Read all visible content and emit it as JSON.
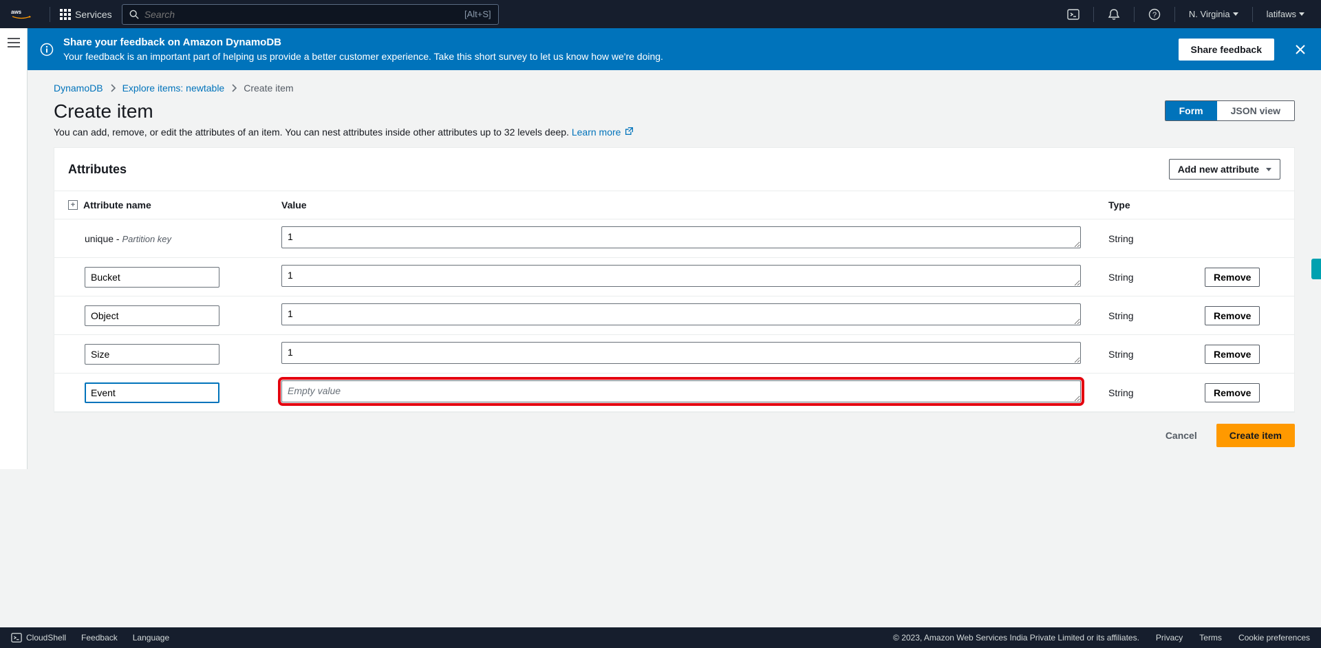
{
  "topnav": {
    "services_label": "Services",
    "search_placeholder": "Search",
    "search_shortcut": "[Alt+S]",
    "region": "N. Virginia",
    "user": "latifaws"
  },
  "banner": {
    "title": "Share your feedback on Amazon DynamoDB",
    "desc": "Your feedback is an important part of helping us provide a better customer experience. Take this short survey to let us know how we're doing.",
    "button": "Share feedback"
  },
  "breadcrumbs": {
    "root": "DynamoDB",
    "explore": "Explore items: newtable",
    "current": "Create item"
  },
  "page": {
    "title": "Create item",
    "desc_prefix": "You can add, remove, or edit the attributes of an item. You can nest attributes inside other attributes up to 32 levels deep. ",
    "learn_more": "Learn more"
  },
  "toggle": {
    "form": "Form",
    "json": "JSON view"
  },
  "panel": {
    "title": "Attributes",
    "add_button": "Add new attribute",
    "cols": {
      "name": "Attribute name",
      "value": "Value",
      "type": "Type"
    },
    "remove": "Remove",
    "empty_placeholder": "Empty value"
  },
  "attributes": {
    "pk": {
      "name": "unique",
      "label": "Partition key",
      "value": "1",
      "type": "String"
    },
    "rows": [
      {
        "name": "Bucket",
        "value": "1",
        "type": "String"
      },
      {
        "name": "Object",
        "value": "1",
        "type": "String"
      },
      {
        "name": "Size",
        "value": "1",
        "type": "String"
      },
      {
        "name": "Event",
        "value": "",
        "type": "String",
        "focused": true,
        "highlight": true
      }
    ]
  },
  "actions": {
    "cancel": "Cancel",
    "create": "Create item"
  },
  "footer": {
    "cloudshell": "CloudShell",
    "feedback": "Feedback",
    "language": "Language",
    "copyright": "© 2023, Amazon Web Services India Private Limited or its affiliates.",
    "privacy": "Privacy",
    "terms": "Terms",
    "cookies": "Cookie preferences"
  }
}
